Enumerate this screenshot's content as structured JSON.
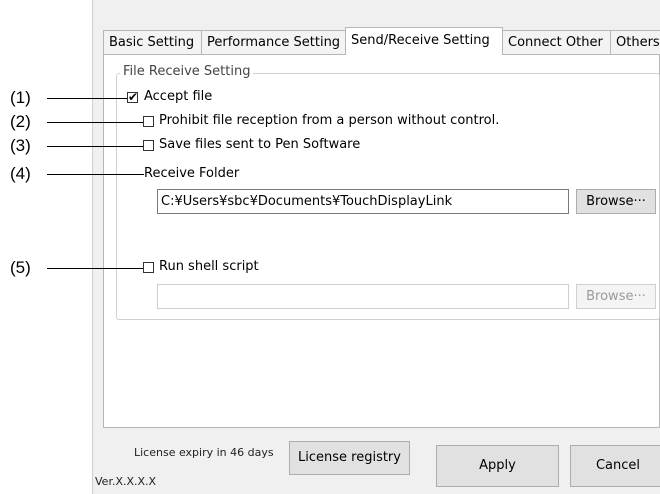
{
  "tabs": [
    {
      "label": "Basic Setting"
    },
    {
      "label": "Performance Setting"
    },
    {
      "label": "Send/Receive Setting"
    },
    {
      "label": "Connect Other"
    },
    {
      "label": "Others"
    }
  ],
  "active_tab": "Send/Receive Setting",
  "file_receive": {
    "group_title": "File Receive Setting",
    "accept_file": {
      "label": "Accept file",
      "checked": true
    },
    "prohibit": {
      "label": "Prohibit file reception from a person without control.",
      "checked": false
    },
    "save_pen": {
      "label": "Save files sent to Pen Software",
      "checked": false
    },
    "receive_folder_label": "Receive Folder",
    "receive_folder_value": "C:¥Users¥sbc¥Documents¥TouchDisplayLink",
    "browse_label": "Browse···",
    "run_shell": {
      "label": "Run shell script",
      "checked": false
    },
    "shell_value": "",
    "shell_browse_label": "Browse···"
  },
  "footer": {
    "license_text": "License expiry in 46 days",
    "version": "Ver.X.X.X.X",
    "license_button": "License registry",
    "apply_button": "Apply",
    "cancel_button": "Cancel"
  },
  "callouts": [
    "(1)",
    "(2)",
    "(3)",
    "(4)",
    "(5)"
  ],
  "colors": {
    "window_bg": "#f0f0f0",
    "panel_bg": "#ffffff",
    "button_bg": "#e1e1e1"
  }
}
